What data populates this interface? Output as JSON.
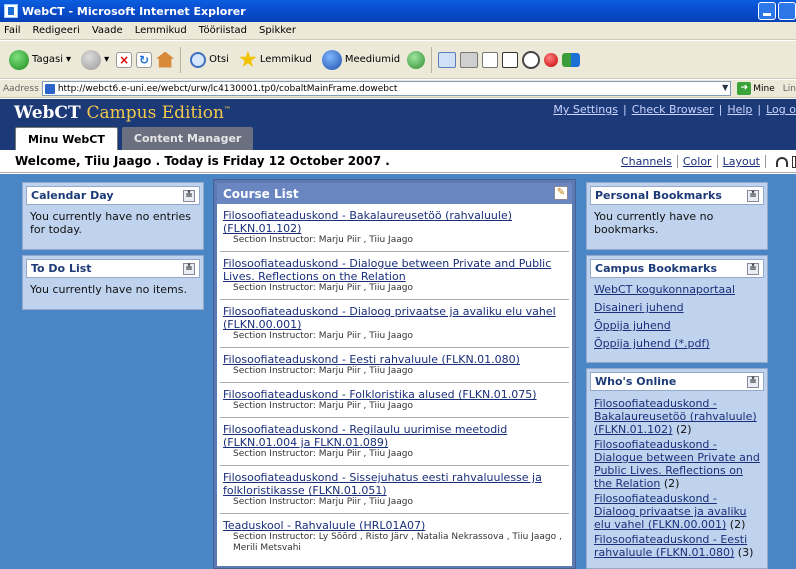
{
  "window": {
    "title": "WebCT - Microsoft Internet Explorer"
  },
  "menu": [
    "Fail",
    "Redigeeri",
    "Vaade",
    "Lemmikud",
    "Tööriistad",
    "Spikker"
  ],
  "toolbar": {
    "back_label": "Tagasi",
    "search_label": "Otsi",
    "favorites_label": "Lemmikud",
    "media_label": "Meediumid"
  },
  "address": {
    "label": "Aadress",
    "url": "http://webct6.e-uni.ee/webct/urw/lc4130001.tp0/cobaltMainFrame.dowebct",
    "go_label": "Mine",
    "links_label": "Lin"
  },
  "header": {
    "brand_webct": "WebCT",
    "brand_campus": "Campus Edition",
    "brand_tm": "™",
    "links": [
      "My Settings",
      "Check Browser",
      "Help",
      "Log o"
    ]
  },
  "tabs": [
    "Minu WebCT",
    "Content Manager"
  ],
  "welcome": {
    "text": "Welcome, Tiiu Jaago . Today is Friday 12 October 2007 .",
    "links": [
      "Channels",
      "Color",
      "Layout"
    ]
  },
  "left": {
    "calendar": {
      "title": "Calendar Day",
      "body": "You currently have no entries for today."
    },
    "todo": {
      "title": "To Do List",
      "body": "You currently have no items."
    }
  },
  "course_list": {
    "title": "Course List",
    "items": [
      {
        "title": "Filosoofiateaduskond - Bakalaureusetöö (rahvaluule) (FLKN.01.102)",
        "instructor": "Section Instructor: Marju Piir , Tiiu Jaago"
      },
      {
        "title": "Filosoofiateaduskond - Dialogue between Private and Public Lives. Reflections on the Relation",
        "instructor": "Section Instructor: Marju Piir , Tiiu Jaago"
      },
      {
        "title": "Filosoofiateaduskond - Dialoog privaatse ja avaliku elu vahel (FLKN.00.001)",
        "instructor": "Section Instructor: Marju Piir , Tiiu Jaago"
      },
      {
        "title": "Filosoofiateaduskond - Eesti rahvaluule (FLKN.01.080)",
        "instructor": "Section Instructor: Marju Piir , Tiiu Jaago"
      },
      {
        "title": "Filosoofiateaduskond - Folkloristika alused (FLKN.01.075)",
        "instructor": "Section Instructor: Marju Piir , Tiiu Jaago"
      },
      {
        "title": "Filosoofiateaduskond - Regilaulu uurimise meetodid (FLKN.01.004 ja FLKN.01.089)",
        "instructor": "Section Instructor: Marju Piir , Tiiu Jaago"
      },
      {
        "title": "Filosoofiateaduskond - Sissejuhatus eesti rahvaluulesse ja folkloristikasse (FLKN.01.051)",
        "instructor": "Section Instructor: Marju Piir , Tiiu Jaago"
      },
      {
        "title": "Teaduskool - Rahvaluule (HRL01A07)",
        "instructor": "Section Instructor: Ly Sõõrd , Risto Järv , Natalia Nekrassova , Tiiu Jaago , Merili Metsvahi"
      }
    ]
  },
  "right": {
    "personal": {
      "title": "Personal Bookmarks",
      "body": "You currently have no bookmarks."
    },
    "campus": {
      "title": "Campus Bookmarks",
      "links": [
        "WebCT kogukonnaportaal",
        "Disaineri juhend",
        "Õppija juhend",
        "Õppija juhend (*.pdf)"
      ]
    },
    "online": {
      "title": "Who's Online",
      "items": [
        {
          "link": "Filosoofiateaduskond - Bakalaureusetöö (rahvaluule) (FLKN.01.102)",
          "count": " (2)"
        },
        {
          "link": "Filosoofiateaduskond - Dialogue between Private and Public Lives. Reflections on the Relation",
          "count": " (2)"
        },
        {
          "link": "Filosoofiateaduskond - Dialoog privaatse ja avaliku elu vahel (FLKN.00.001)",
          "count": " (2)"
        },
        {
          "link": "Filosoofiateaduskond - Eesti rahvaluule (FLKN.01.080)",
          "count": " (3)"
        }
      ]
    }
  }
}
